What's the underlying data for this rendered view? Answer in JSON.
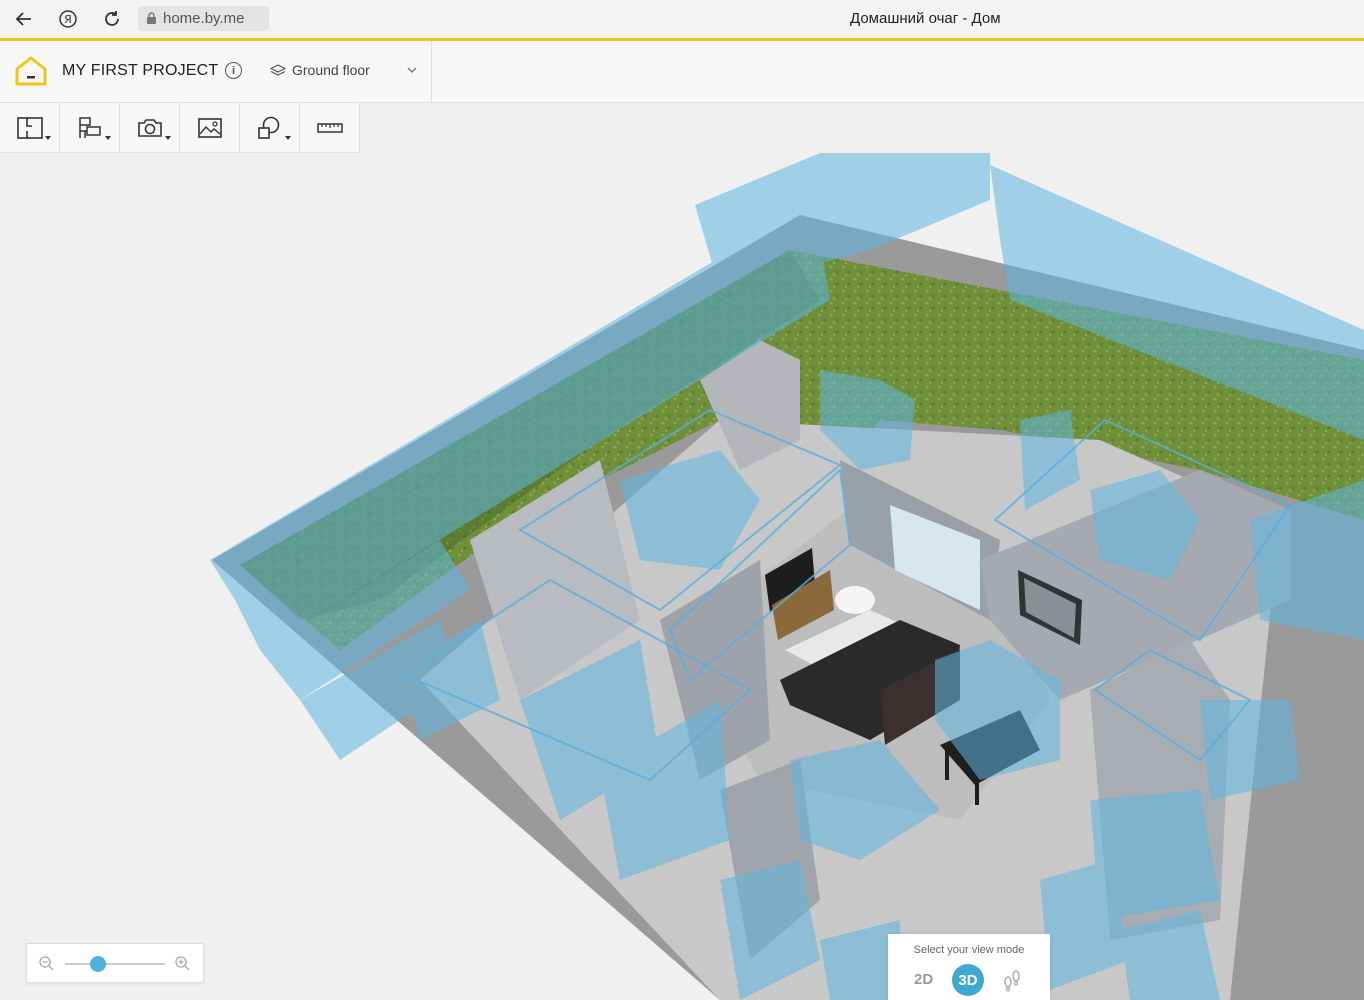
{
  "browser": {
    "url": "home.by.me",
    "title": "Домашний очаг - Дом"
  },
  "project": {
    "name": "MY FIRST PROJECT",
    "floor": "Ground floor"
  },
  "toolbar": {
    "tools": [
      "floorplan-icon",
      "furniture-icon",
      "camera-icon",
      "image-icon",
      "shapes-icon",
      "ruler-icon"
    ]
  },
  "view_mode": {
    "label": "Select your view mode",
    "options": [
      "2D",
      "3D"
    ],
    "selected": "3D"
  },
  "zoom": {
    "level": 0.33
  },
  "colors": {
    "accent": "#f2c615",
    "active": "#3fa9d4"
  }
}
